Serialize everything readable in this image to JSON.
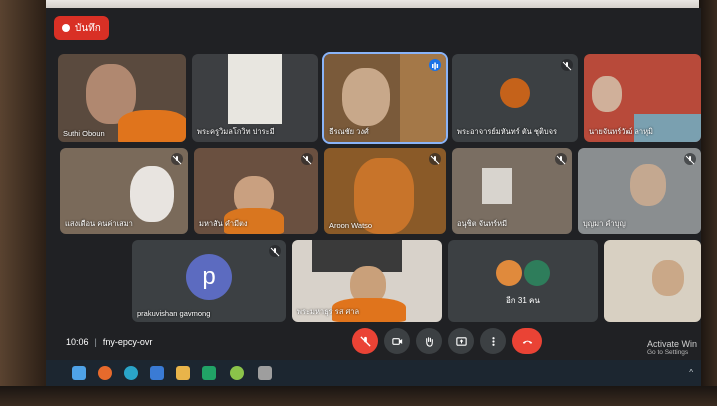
{
  "recording": {
    "label": "บันทึก"
  },
  "participants": [
    {
      "name": "Suthi Oboun"
    },
    {
      "name": "พระครูวิมลโกวิท ปาระมี"
    },
    {
      "name": "ธีรณชัย วงศ์"
    },
    {
      "name": "พระอาจารย์มหันทร์ ตัน ชุติบจร"
    },
    {
      "name": "นายจันทร์วัฒ์ ลาหุมิ"
    },
    {
      "name": "แสงเดือน คนค่าเสมา"
    },
    {
      "name": "มหาสัน คำมีตง"
    },
    {
      "name": "Aroon Watso"
    },
    {
      "name": "อนุชิต จันทร์หมี"
    },
    {
      "name": "บุญมา คำบุญ"
    },
    {
      "name": "prakuvishan gavmong"
    },
    {
      "name": "พระมหาธุร รส ศาล"
    },
    {
      "name": "อีก 31 คน"
    }
  ],
  "avatar_letter": "p",
  "meeting": {
    "time": "10:06",
    "separator": "|",
    "code": "fny-epcy-ovr"
  },
  "windows_watermark": {
    "title": "Activate Win",
    "subtitle": "Go to Settings"
  },
  "tray": {
    "arrow": "^"
  },
  "colors": {
    "accent": "#8ab4f8",
    "end_call": "#ea4335",
    "avatar": "#5c6bc0"
  }
}
